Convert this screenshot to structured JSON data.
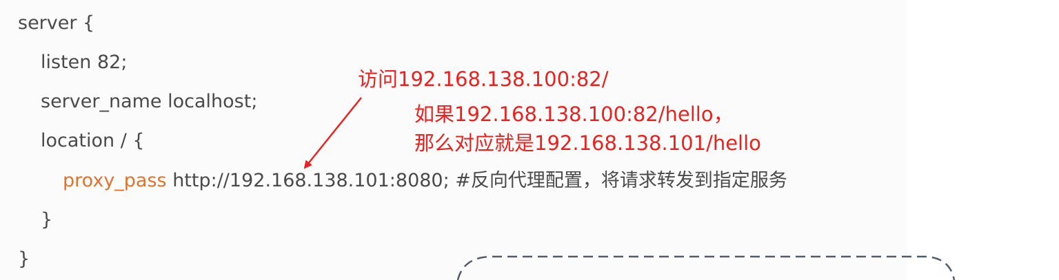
{
  "code": {
    "line1": "server {",
    "line2": "listen 82;",
    "line3": "server_name localhost;",
    "line4": "location / {",
    "line5_keyword": "proxy_pass",
    "line5_rest": " http://192.168.138.101:8080; #反向代理配置，将请求转发到指定服务",
    "line6": "}",
    "line7": "}"
  },
  "annotations": {
    "access": "访问192.168.138.100:82/",
    "if_line": "如果192.168.138.100:82/hello，",
    "then_line": "那么对应就是192.168.138.101/hello"
  },
  "colors": {
    "code_text": "#4a4a4a",
    "keyword": "#e0722a",
    "annotation": "#e8231f",
    "dashed_box": "#4f5b6b"
  }
}
